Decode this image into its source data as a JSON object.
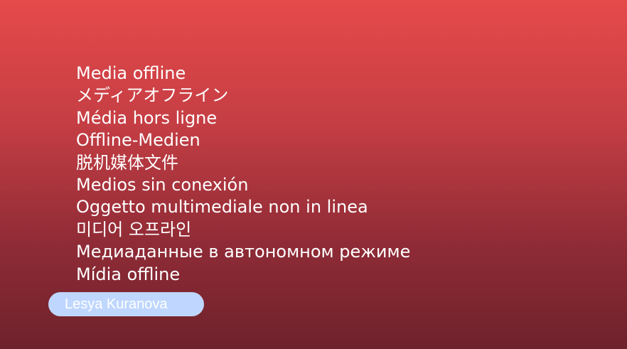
{
  "messages": [
    "Media offline",
    "メディアオフライン",
    "Média hors ligne",
    "Offline-Medien",
    "脱机媒体文件",
    "Medios sin conexión",
    "Oggetto multimediale non in linea",
    "미디어 오프라인",
    "Медиаданные в автономном режиме",
    "Mídia offline"
  ],
  "author": {
    "name": "Lesya Kuranova"
  },
  "colors": {
    "background_top": "#e64a4a",
    "background_bottom": "#6e222c",
    "pill": "#bfd7ff",
    "text": "#ffffff"
  }
}
